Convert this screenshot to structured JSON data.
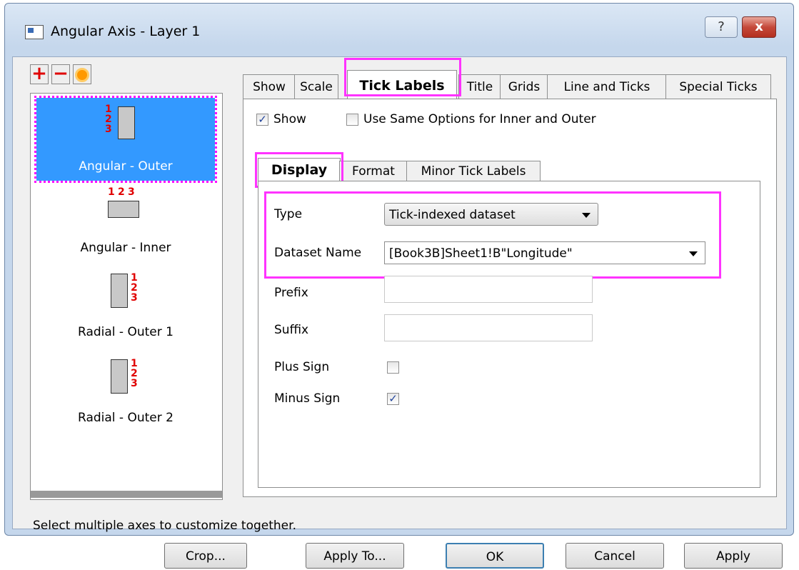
{
  "window": {
    "title": "Angular Axis - Layer 1",
    "help_label": "?",
    "close_label": "x"
  },
  "toolbar": {
    "add_label": "+",
    "remove_label": "−",
    "circle_icon": "orange-circle-icon"
  },
  "axis_list": [
    {
      "label": "Angular - Outer",
      "selected": true,
      "digits": [
        "1",
        "2",
        "3"
      ]
    },
    {
      "label": "Angular - Inner",
      "selected": false,
      "digits": [
        "1",
        "2",
        "3"
      ]
    },
    {
      "label": "Radial - Outer 1",
      "selected": false,
      "digits": [
        "1",
        "2",
        "3"
      ]
    },
    {
      "label": "Radial - Outer 2",
      "selected": false,
      "digits": [
        "1",
        "2",
        "3"
      ]
    }
  ],
  "tabs": [
    "Show",
    "Scale",
    "Tick Labels",
    "Title",
    "Grids",
    "Line and Ticks",
    "Special Ticks"
  ],
  "active_tab": "Tick Labels",
  "show_checkbox": {
    "label": "Show",
    "checked": true
  },
  "same_options_checkbox": {
    "label": "Use Same Options for Inner and Outer",
    "checked": false
  },
  "subtabs": [
    "Display",
    "Format",
    "Minor Tick Labels"
  ],
  "active_subtab": "Display",
  "form": {
    "type_label": "Type",
    "type_value": "Tick-indexed dataset",
    "dataset_label": "Dataset Name",
    "dataset_value": "[Book3B]Sheet1!B\"Longitude\"",
    "prefix_label": "Prefix",
    "prefix_value": "",
    "suffix_label": "Suffix",
    "suffix_value": "",
    "plus_label": "Plus Sign",
    "plus_checked": false,
    "minus_label": "Minus Sign",
    "minus_checked": true
  },
  "status_text": "Select multiple axes to customize together.",
  "buttons": {
    "crop": "Crop...",
    "apply_to": "Apply To...",
    "ok": "OK",
    "cancel": "Cancel",
    "apply": "Apply"
  },
  "colors": {
    "highlight": "#ff33ff",
    "selection": "#3399ff",
    "accent_red": "#e00000"
  }
}
